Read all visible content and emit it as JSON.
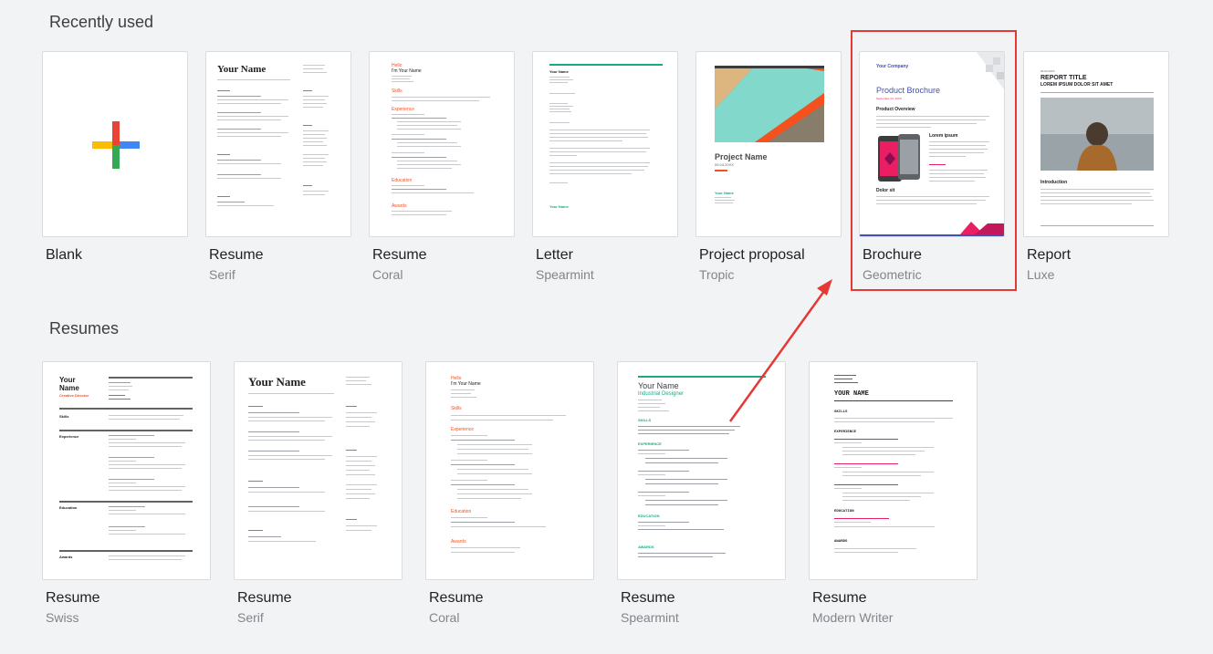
{
  "sections": {
    "recent_title": "Recently used",
    "resumes_title": "Resumes"
  },
  "recent": [
    {
      "name": "Blank",
      "sub": ""
    },
    {
      "name": "Resume",
      "sub": "Serif"
    },
    {
      "name": "Resume",
      "sub": "Coral"
    },
    {
      "name": "Letter",
      "sub": "Spearmint"
    },
    {
      "name": "Project proposal",
      "sub": "Tropic"
    },
    {
      "name": "Brochure",
      "sub": "Geometric"
    },
    {
      "name": "Report",
      "sub": "Luxe"
    }
  ],
  "resumes": [
    {
      "name": "Resume",
      "sub": "Swiss"
    },
    {
      "name": "Resume",
      "sub": "Serif"
    },
    {
      "name": "Resume",
      "sub": "Coral"
    },
    {
      "name": "Resume",
      "sub": "Spearmint"
    },
    {
      "name": "Resume",
      "sub": "Modern Writer"
    }
  ],
  "previews": {
    "serif_name": "Your Name",
    "coral_name": "Hello",
    "coral_title": "I'm Your Name",
    "coral_skills": "Skills",
    "coral_experience": "Experience",
    "coral_education": "Education",
    "coral_awards": "Awards",
    "letter_name": "Your Name",
    "letter_sign": "Your Name",
    "proposal_title": "Project Name",
    "proposal_date": "09.04.20XX",
    "proposal_company": "Your Name",
    "brochure_company": "Your Company",
    "brochure_title": "Product Brochure",
    "brochure_date": "September 04, 20XX",
    "brochure_overview": "Product Overview",
    "brochure_lorem": "Lorem ipsum",
    "brochure_dolor": "Dolor sit",
    "report_label": "09.04.20XX",
    "report_title": "REPORT TITLE",
    "report_subtitle": "LOREM IPSUM DOLOR SIT AMET",
    "report_intro": "Introduction",
    "swiss_name1": "Your",
    "swiss_name2": "Name",
    "swiss_role": "Creative Director",
    "swiss_skills": "Skills",
    "swiss_experience": "Experience",
    "swiss_education": "Education",
    "swiss_awards": "Awards",
    "serif2_name": "Your Name",
    "coral2_name": "Hello",
    "coral2_title": "I'm Your Name",
    "coral2_skills": "Skills",
    "coral2_experience": "Experience",
    "coral2_education": "Education",
    "coral2_awards": "Awards",
    "spear_name": "Your Name",
    "spear_role": "Industrial Designer",
    "spear_skills": "SKILLS",
    "spear_experience": "EXPERIENCE",
    "spear_education": "EDUCATION",
    "spear_awards": "AWARDS",
    "mw_name": "YOUR NAME",
    "mw_skills": "SKILLS",
    "mw_experience": "EXPERIENCE",
    "mw_education": "EDUCATION",
    "mw_awards": "AWARDS"
  },
  "colors": {
    "highlight": "#e53935",
    "coral": "#f4511e",
    "spearmint": "#1aa987",
    "brochure_blue": "#3f51b5",
    "brochure_pink": "#e91e63"
  },
  "icons": {
    "blank": "plus-icon"
  }
}
